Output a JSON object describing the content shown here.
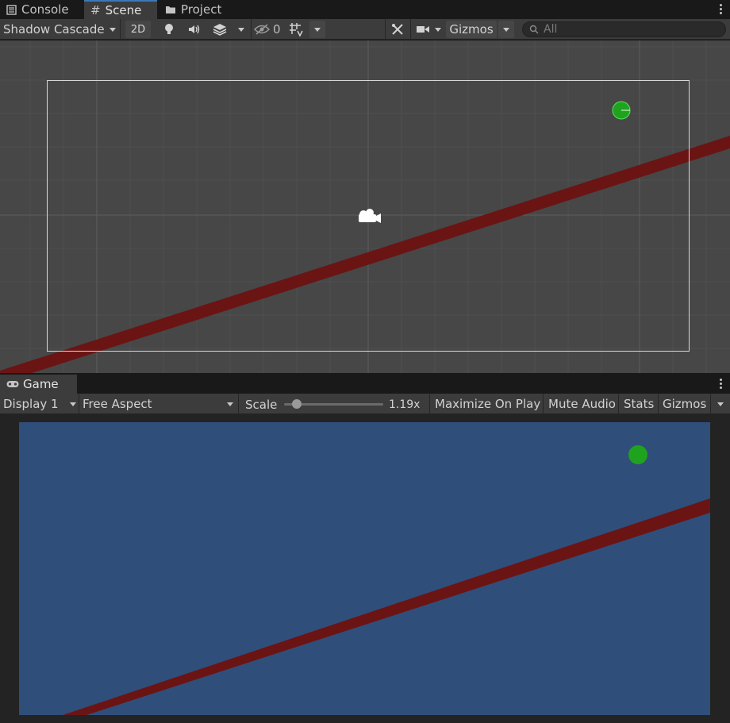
{
  "tabs": {
    "console": "Console",
    "scene": "Scene",
    "project": "Project"
  },
  "scene_toolbar": {
    "draw_mode": "Shadow Cascade",
    "mode_2d": "2D",
    "hidden_count": "0",
    "gizmos": "Gizmos",
    "search_placeholder": "All"
  },
  "game": {
    "tab_label": "Game",
    "display": "Display 1",
    "aspect": "Free Aspect",
    "scale_label": "Scale",
    "scale_value": "1.19x",
    "maximize": "Maximize On Play",
    "mute": "Mute Audio",
    "stats": "Stats",
    "gizmos": "Gizmos"
  },
  "colors": {
    "accent": "#3a79bb",
    "scene_bg": "#474747",
    "game_bg": "#304e7a",
    "line": "#6b1414",
    "ball": "#1fa31f"
  },
  "icons": [
    "console-icon",
    "grid-icon",
    "folder-icon",
    "lightbulb-icon",
    "audio-icon",
    "effects-icon",
    "visibility-icon",
    "grid-snap-icon",
    "tools-icon",
    "camera-icon",
    "search-icon",
    "gamepad-icon",
    "camera-gizmo-icon",
    "kebab-menu-icon"
  ]
}
